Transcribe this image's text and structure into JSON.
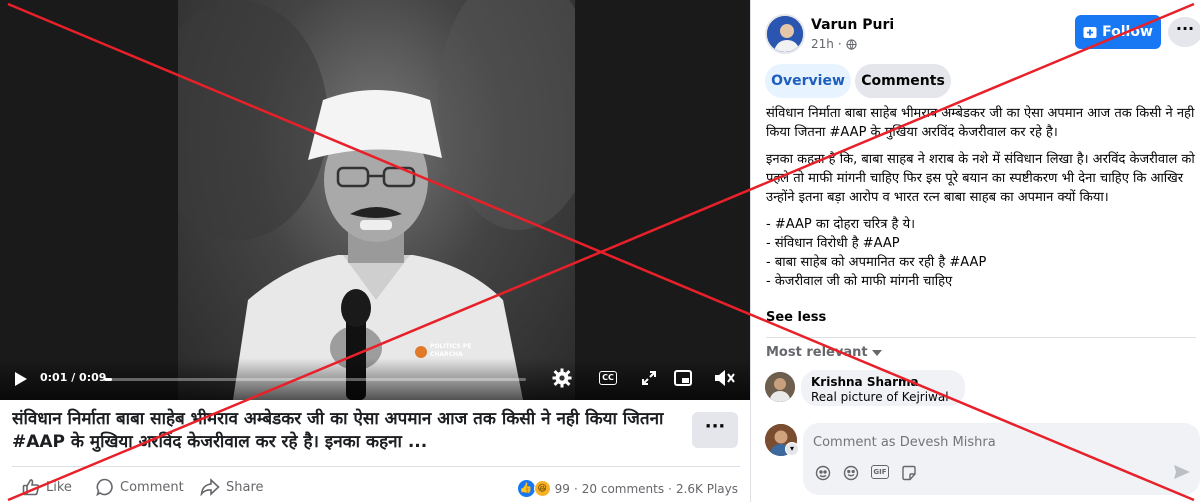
{
  "video": {
    "time": "0:01 / 0:09",
    "progress": 0.02,
    "watermark": "POLITICS PE CHARCHA",
    "controls": {
      "play_icon": "play-icon",
      "settings_icon": "gear-icon",
      "cc_label": "CC",
      "expand_icon": "expand-icon",
      "pip_icon": "picture-in-picture-icon",
      "mute_icon": "mute-icon"
    }
  },
  "caption": {
    "text": "संविधान निर्माता बाबा साहेब भीमराव अम्बेडकर जी का ऐसा अपमान आज तक किसी ने नही किया जितना #AAP के मुखिया अरविंद केजरीवाल कर रहे है। इनका कहना ...",
    "more_label": "···"
  },
  "actions": {
    "like_label": "Like",
    "comment_label": "Comment",
    "share_label": "Share",
    "reaction_count": "99",
    "comments_count": "20 comments",
    "plays_count": "2.6K Plays",
    "separator": "·"
  },
  "post": {
    "author": "Varun Puri",
    "time": "21h",
    "follow_label": "Follow",
    "more_label": "···",
    "tabs": [
      {
        "label": "Overview",
        "active": true
      },
      {
        "label": "Comments",
        "active": false
      }
    ],
    "body": {
      "paragraph1": "संविधान निर्माता बाबा साहेब भीमराव अम्बेडकर जी का ऐसा अपमान आज तक किसी ने नही किया जितना #AAP के मुखिया अरविंद केजरीवाल कर रहे है।",
      "paragraph2": "इनका कहना है कि, बाबा साहब ने शराब के नशे में संविधान लिखा है। अरविंद केजरीवाल को पहले तो माफी मांगनी चाहिए फिर इस पूरे बयान का स्पष्टीकरण भी देना चाहिए कि आखिर उन्होंने इतना बड़ा आरोप व भारत रत्न बाबा साहब का अपमान क्यों किया।",
      "bullets": [
        "- #AAP का दोहरा चरित्र है ये।",
        "- संविधान विरोधी है #AAP",
        "- बाबा साहेब को अपमानित कर रही है #AAP",
        "- केजरीवाल जी को माफी मांगनी चाहिए"
      ]
    },
    "see_less_label": "See less",
    "sort_label": "Most relevant"
  },
  "comments": [
    {
      "author": "Krishna Sharma",
      "text": "Real picture of Kejriwal"
    }
  ],
  "composer": {
    "placeholder": "Comment as Devesh Mishra",
    "tools": [
      "avatar-sticker-icon",
      "emoji-icon",
      "gif-icon",
      "sticker-icon"
    ],
    "gif_label": "GIF",
    "send_icon": "send-icon"
  },
  "colors": {
    "accent": "#1877f2",
    "overlay_cross": "#e8202a",
    "text_primary": "#050505",
    "text_secondary": "#65676b"
  }
}
